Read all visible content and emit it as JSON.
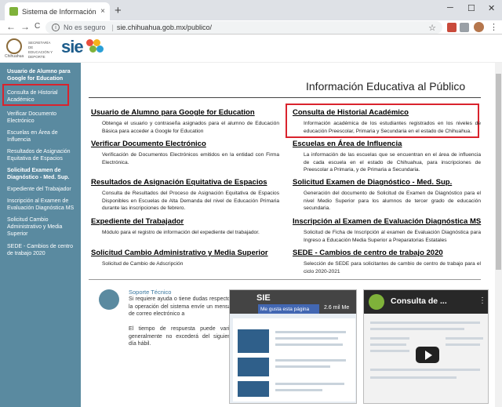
{
  "browser": {
    "tab_title": "Sistema de Información Educativ",
    "tab_close": "×",
    "new_tab": "+",
    "win_min": "─",
    "win_max": "☐",
    "win_close": "✕",
    "back": "←",
    "forward": "→",
    "reload": "C",
    "security_label": "No es seguro",
    "url": "sie.chihuahua.gob.mx/publico/",
    "star": "☆",
    "menu": "⋮"
  },
  "header": {
    "gob_label": "Chihuahua",
    "sec_label": "SECRETARÍA DE EDUCACIÓN Y DEPORTE",
    "logo_text": "sie"
  },
  "sidebar": {
    "items": [
      {
        "label": "Usuario de Alumno para Google for Education",
        "bold": true
      },
      {
        "label": "Consulta de Historial Académico",
        "bold": false
      },
      {
        "label": "Verificar Documento Electrónico",
        "bold": false
      },
      {
        "label": "Escuelas en Área de Influencia",
        "bold": false
      },
      {
        "label": "Resultados de Asignación Equitativa de Espacios",
        "bold": false
      },
      {
        "label": "Solicitud Examen de Diagnóstico - Med. Sup.",
        "bold": true
      },
      {
        "label": "Expediente del Trabajador",
        "bold": false
      },
      {
        "label": "Inscripción al Examen de Evaluación Diagnóstica MS",
        "bold": false
      },
      {
        "label": "Solicitud Cambio Administrativo y Media Superior",
        "bold": false
      },
      {
        "label": "SEDE - Cambios de centro de trabajo 2020",
        "bold": false
      }
    ]
  },
  "main": {
    "title": "Información Educativa al Público",
    "sections": [
      {
        "title": "Usuario de Alumno para Google for Education",
        "desc": "Obtenga el usuario y contraseña asignados para el alumno de Educación Básica para acceder a Google for Education"
      },
      {
        "title": "Consulta de Historial Académico",
        "desc": "Información académica de los estudiantes registrados en los niveles de educación Preescolar, Primaria y Secundaria en el estado de Chihuahua."
      },
      {
        "title": "Verificar Documento Electrónico",
        "desc": "Verificación de Documentos Electrónicos emitidos en la entidad con Firma Electrónica."
      },
      {
        "title": "Escuelas en Área de Influencia",
        "desc": "La información de las escuelas que se encuentran en el área de influencia de cada escuela en el estado de Chihuahua, para inscripciones de Preescolar a Primaria, y de Primaria a Secundaria."
      },
      {
        "title": "Resultados de Asignación Equitativa de Espacios",
        "desc": "Consulta de Resultados del Proceso de Asignación Equitativa de Espacios Disponibles en Escuelas de Alta Demanda del nivel de Educación Primaria durante las inscripciones de febrero."
      },
      {
        "title": "Solicitud Examen de Diagnóstico - Med. Sup.",
        "desc": "Generación del documento de Solicitud de Examen de Diagnóstico para el nivel Medio Superior para los alumnos de tercer grado de educación secundaria."
      },
      {
        "title": "Expediente del Trabajador",
        "desc": "Módulo para el registro de información del expediente del trabajador."
      },
      {
        "title": "Inscripción al Examen de Evaluación Diagnóstica MS",
        "desc": "Solicitud de Ficha de Inscripción al examen de Evaluación Diagnóstica para Ingreso a Educación Media Superior a Preparatorias Estatales"
      },
      {
        "title": "Solicitud Cambio Administrativo y Media Superior",
        "desc": "Solicitud de Cambio de Adscripción"
      },
      {
        "title": "SEDE - Cambios de centro de trabajo 2020",
        "desc": "Selección de SEDE para solicitantes de cambio de centro de trabajo para el ciclo 2020-2021"
      }
    ]
  },
  "support": {
    "title": "Soporte Técnico",
    "text1": "Si requiere ayuda o tiene dudas respecto a la operación del sistema envíe un mensaje de correo electrónico a",
    "text2": "El tiempo de respuesta puede variar, generalmente no excederá del siguiente día hábil."
  },
  "videos": {
    "v1_brand": "SIE",
    "v1_like": "Me gusta esta página",
    "v1_meta": "2.6 mil Me",
    "v2_title": "Consulta de ...",
    "v2_menu": "⋮"
  },
  "colors": {
    "sidebar_bg": "#5a8aa0",
    "highlight": "#d9232d",
    "sie_blue": "#1c5c8b"
  }
}
